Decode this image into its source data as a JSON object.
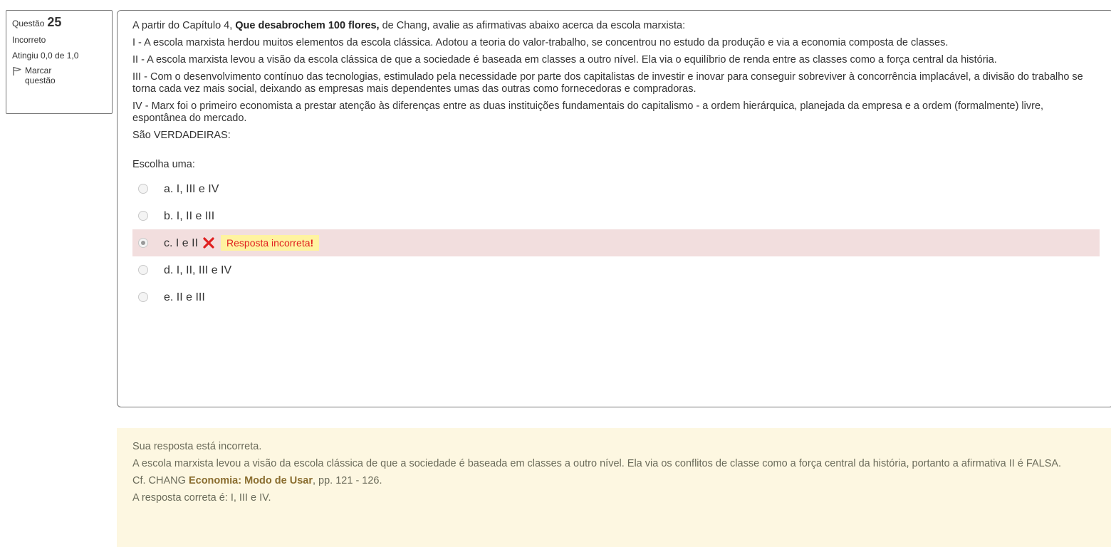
{
  "info": {
    "question_label": "Questão",
    "question_number": "25",
    "state": "Incorreto",
    "grade": "Atingiu 0,0 de 1,0",
    "flag_label": "Marcar questão",
    "flag_icon": "flag-outline-icon"
  },
  "question": {
    "intro_pre": "A partir do Capítulo 4,",
    "intro_bold": "Que desabrochem 100 flores,",
    "intro_post": "de Chang, avalie as afirmativas abaixo acerca da escola marxista:",
    "statement_i": "I - A escola marxista herdou muitos elementos da escola clássica. Adotou a teoria do valor-trabalho, se concentrou no estudo da produção e via a economia composta de classes.",
    "statement_ii": "II - A escola marxista levou a visão da escola clássica de que a sociedade é baseada em classes a outro nível. Ela via o equilíbrio de renda entre as classes como a força central da história.",
    "statement_iii": "III - Com o desenvolvimento contínuo das tecnologias, estimulado pela necessidade por parte dos capitalistas de investir e inovar para conseguir sobreviver à concorrência implacável, a divisão do trabalho se torna cada vez mais social, deixando as empresas mais dependentes umas das outras como fornecedoras e compradoras.",
    "statement_iv": "IV - Marx foi o primeiro economista a prestar atenção às diferenças entre as duas instituições fundamentais do capitalismo - a ordem hierárquica, planejada da empresa e a ordem (formalmente) livre, espontânea do mercado.",
    "closing": "São VERDADEIRAS:",
    "prompt": "Escolha uma:"
  },
  "answers": [
    {
      "label": "a. I, III e IV",
      "selected": false
    },
    {
      "label": "b. I, II e III",
      "selected": false
    },
    {
      "label": "c. I e II",
      "selected": true
    },
    {
      "label": "d. I, II, III e IV",
      "selected": false
    },
    {
      "label": "e. II e III",
      "selected": false
    }
  ],
  "selected_feedback": {
    "text": "Resposta incorreta",
    "bang": "!",
    "icon": "red-x-icon",
    "color": "#e02020"
  },
  "feedback": {
    "general": "Sua resposta está incorreta.",
    "explanation": "A escola marxista levou a visão da escola clássica de que a sociedade é baseada em classes a outro nível. Ela via os conflitos de classe como a força central da história, portanto a afirmativa II é FALSA.",
    "ref_pre": "Cf. CHANG",
    "ref_bold": "Economia: Modo de Usar",
    "ref_post": ", pp. 121 - 126.",
    "correct_answer": "A resposta correta é: I, III e IV."
  },
  "colors": {
    "wrong_row_bg": "#f2dede",
    "feedback_bg": "#fdf7e1",
    "badge_bg": "#fff3a0"
  }
}
